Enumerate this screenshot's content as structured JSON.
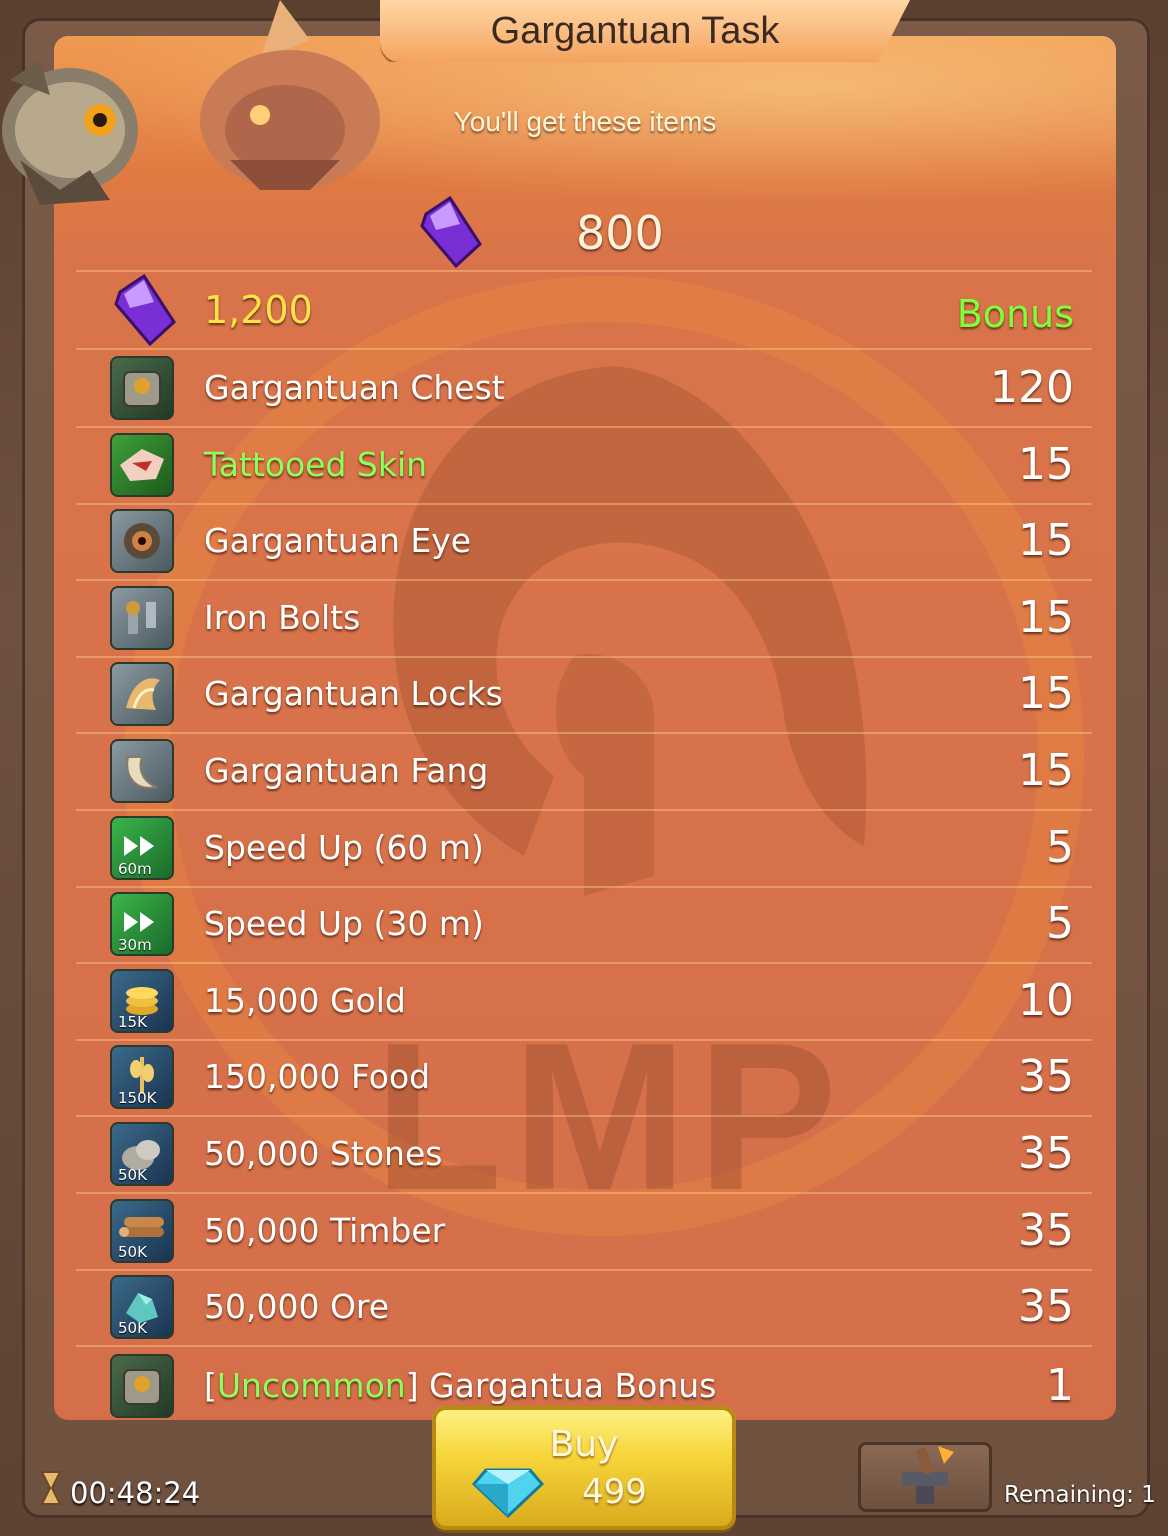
{
  "header": {
    "title": "Gargantuan Task",
    "subtitle": "You'll get these items"
  },
  "gem_offer": {
    "icon": "purple-gem-icon",
    "amount": "800"
  },
  "bonus_row": {
    "icon": "purple-gem-icon",
    "amount": "1,200",
    "tag": "Bonus"
  },
  "items": [
    {
      "icon": "gargantuan-chest-icon",
      "label": "Gargantuan Chest",
      "qty": "120",
      "tag": ""
    },
    {
      "icon": "tattooed-skin-icon",
      "label": "Tattooed Skin",
      "qty": "15",
      "tag": ""
    },
    {
      "icon": "gargantuan-eye-icon",
      "label": "Gargantuan Eye",
      "qty": "15",
      "tag": ""
    },
    {
      "icon": "iron-bolts-icon",
      "label": "Iron Bolts",
      "qty": "15",
      "tag": ""
    },
    {
      "icon": "gargantuan-locks-icon",
      "label": "Gargantuan Locks",
      "qty": "15",
      "tag": ""
    },
    {
      "icon": "gargantuan-fang-icon",
      "label": "Gargantuan Fang",
      "qty": "15",
      "tag": ""
    },
    {
      "icon": "speed-up-icon",
      "label": "Speed Up (60 m)",
      "qty": "5",
      "tag": "60m"
    },
    {
      "icon": "speed-up-icon",
      "label": "Speed Up (30 m)",
      "qty": "5",
      "tag": "30m"
    },
    {
      "icon": "gold-icon",
      "label": "15,000 Gold",
      "qty": "10",
      "tag": "15K"
    },
    {
      "icon": "food-icon",
      "label": "150,000 Food",
      "qty": "35",
      "tag": "150K"
    },
    {
      "icon": "stones-icon",
      "label": "50,000 Stones",
      "qty": "35",
      "tag": "50K"
    },
    {
      "icon": "timber-icon",
      "label": "50,000 Timber",
      "qty": "35",
      "tag": "50K"
    },
    {
      "icon": "ore-icon",
      "label": "50,000 Ore",
      "qty": "35",
      "tag": "50K"
    }
  ],
  "last_item": {
    "icon": "gargantuan-chest-icon",
    "bracket_open": "[",
    "rarity": "Uncommon",
    "bracket_close": "]",
    "name": " Gargantua Bonus",
    "qty": "1"
  },
  "footer": {
    "timer": "00:48:24",
    "buy_label": "Buy",
    "price": "499",
    "remaining": "Remaining: 1"
  },
  "watermark": "LMP",
  "colors": {
    "panel": "#d46f4a",
    "bonus_green": "#7dff3a",
    "gold_yellow": "#ffe24a",
    "buy_button": "#f6d63a"
  }
}
